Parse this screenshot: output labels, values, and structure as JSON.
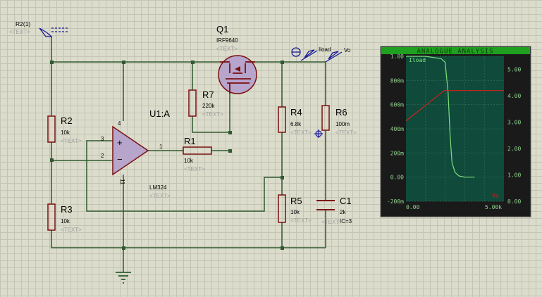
{
  "schematic": {
    "terminal": {
      "label": "R2(1)",
      "text": "<TEXT>"
    },
    "components": [
      {
        "id": "q1",
        "ref": "Q1",
        "value": "IRF9640",
        "text": "<TEXT>"
      },
      {
        "id": "r7",
        "ref": "R7",
        "value": "220k",
        "text": "<TEXT>"
      },
      {
        "id": "u1",
        "ref": "U1:A",
        "value": "LM324",
        "text": "<TEXT>"
      },
      {
        "id": "r1",
        "ref": "R1",
        "value": "10k",
        "text": "<TEXT>"
      },
      {
        "id": "r2",
        "ref": "R2",
        "value": "10k",
        "text": "<TEXT>"
      },
      {
        "id": "r3",
        "ref": "R3",
        "value": "10k",
        "text": "<TEXT>"
      },
      {
        "id": "r4",
        "ref": "R4",
        "value": "6.8k",
        "text": "<TEXT>"
      },
      {
        "id": "r5",
        "ref": "R5",
        "value": "10k",
        "text": "<TEXT>"
      },
      {
        "id": "r6",
        "ref": "R6",
        "value": "100m",
        "text": "<TEXT>"
      },
      {
        "id": "c1",
        "ref": "C1",
        "value": "2k",
        "extra": "IC=3",
        "text": "<TEXT>"
      }
    ],
    "pins": {
      "u1_in_plus": "3",
      "u1_in_minus": "2",
      "u1_out": "1",
      "u1_vcc": "4",
      "u1_gnd": "11"
    },
    "probes": {
      "current": "Iload",
      "voltage": "Vo"
    }
  },
  "analysis": {
    "title": "ANALOGUE ANALYSIS",
    "left_ticks": [
      "1.00",
      "800m",
      "600m",
      "400m",
      "200m",
      "0.00",
      "-200m"
    ],
    "right_ticks": [
      "5.00",
      "4.00",
      "3.00",
      "2.00",
      "1.00",
      "0.00"
    ],
    "x_ticks": [
      "0.00",
      "5.00k"
    ],
    "trace_label": "Iload",
    "x_label": "Vo",
    "colors": {
      "iload": "#7ee07e",
      "vo": "#d22020",
      "frame": "#1a1a1a",
      "header": "#20a020"
    }
  },
  "chart_data": {
    "type": "line",
    "title": "ANALOGUE ANALYSIS",
    "xlabel": "Vo",
    "xlim": [
      0,
      5000
    ],
    "ylim_left": [
      -0.2,
      1.0
    ],
    "ylim_right": [
      0,
      5.5
    ],
    "series": [
      {
        "name": "Iload",
        "axis": "left",
        "x": [
          0,
          1000,
          1800,
          2000,
          2150,
          2250,
          2350,
          2500,
          2700,
          3000,
          3500
        ],
        "y": [
          1.0,
          1.0,
          0.98,
          0.95,
          0.7,
          0.35,
          0.12,
          0.04,
          0.01,
          0.0,
          0.0
        ]
      },
      {
        "name": "Vo",
        "axis": "right",
        "x": [
          0,
          1950,
          5000
        ],
        "y": [
          3.05,
          4.2,
          4.2
        ]
      }
    ]
  }
}
